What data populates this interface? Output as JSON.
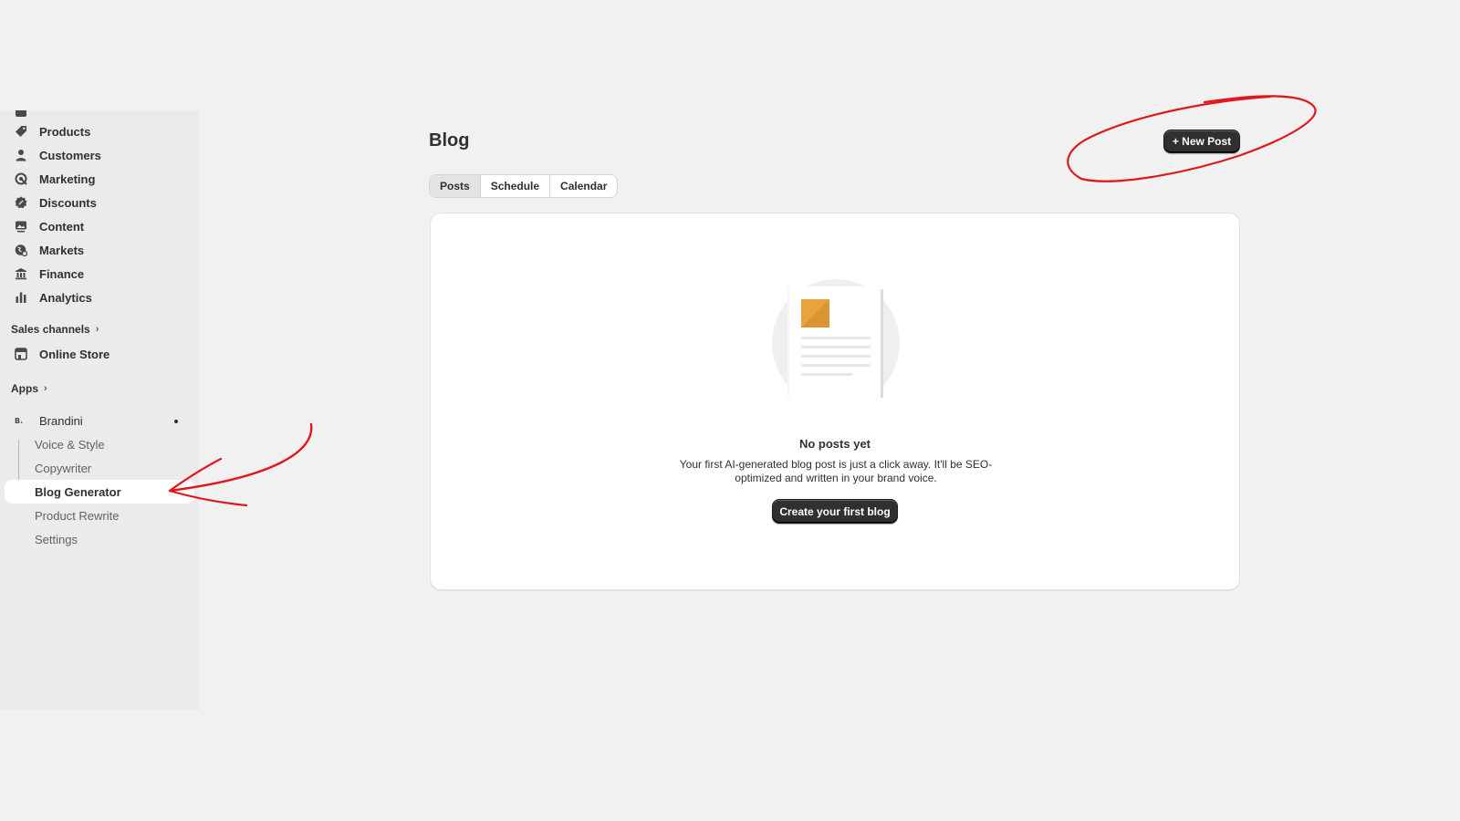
{
  "sidebar": {
    "items": [
      {
        "label": "Products",
        "icon": "tag-icon"
      },
      {
        "label": "Customers",
        "icon": "person-icon"
      },
      {
        "label": "Marketing",
        "icon": "target-icon"
      },
      {
        "label": "Discounts",
        "icon": "discount-icon"
      },
      {
        "label": "Content",
        "icon": "image-icon"
      },
      {
        "label": "Markets",
        "icon": "globe-icon"
      },
      {
        "label": "Finance",
        "icon": "bank-icon"
      },
      {
        "label": "Analytics",
        "icon": "bar-chart-icon"
      }
    ],
    "sales_channels_label": "Sales channels",
    "online_store_label": "Online Store",
    "apps_label": "Apps",
    "app_name": "Brandini",
    "app_sub_items": [
      {
        "label": "Voice & Style"
      },
      {
        "label": "Copywriter"
      },
      {
        "label": "Blog Generator",
        "active": true
      },
      {
        "label": "Product Rewrite"
      },
      {
        "label": "Settings"
      }
    ]
  },
  "page": {
    "title": "Blog",
    "new_post_label": "+ New Post",
    "tabs": [
      {
        "label": "Posts",
        "active": true
      },
      {
        "label": "Schedule"
      },
      {
        "label": "Calendar"
      }
    ],
    "empty_state": {
      "title": "No posts yet",
      "description": "Your first AI-generated blog post is just a click away. It'll be SEO-optimized and written in your brand voice.",
      "cta_label": "Create your first blog"
    }
  },
  "colors": {
    "annotation": "#e0171d",
    "primary_button": "#303030",
    "illustration_accent": "#e8a33d"
  }
}
